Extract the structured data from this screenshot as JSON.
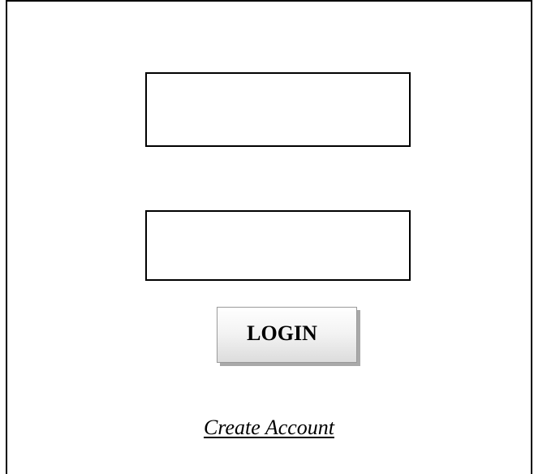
{
  "login_form": {
    "username": {
      "value": "",
      "placeholder": ""
    },
    "password": {
      "value": "",
      "placeholder": ""
    },
    "login_label": "LOGIN",
    "create_account_label": "Create Account"
  }
}
